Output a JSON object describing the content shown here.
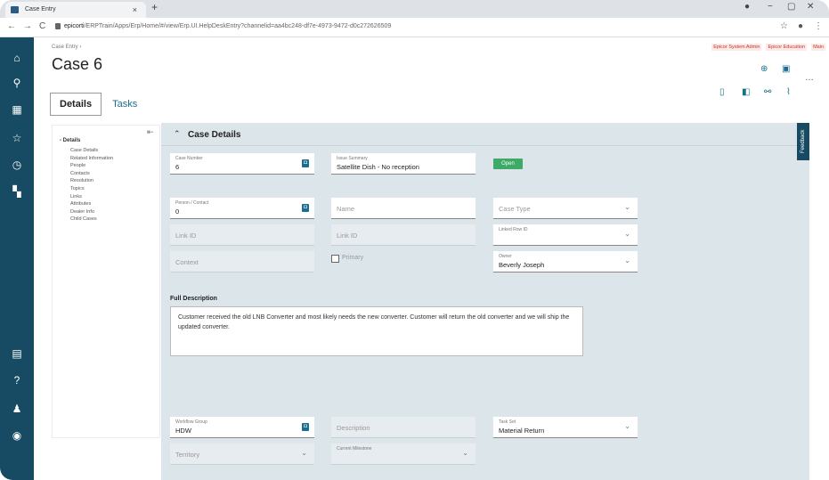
{
  "browser": {
    "tab_title": "Case Entry",
    "tab_close": "×",
    "new_tab": "+",
    "url_host": "epicorti",
    "url_path": "/ERPTrain/Apps/Erp/Home/#/view/Erp.UI.HelpDeskEntry?channelid=aa4bc248-df7e-4973-9472-d0c272626509",
    "back": "←",
    "forward": "→",
    "reload": "C"
  },
  "rail": {
    "icons": [
      "home-icon",
      "search-icon",
      "apps-icon",
      "star-icon",
      "history-icon",
      "dashboard-icon",
      "chat-icon",
      "help-icon",
      "notifications-icon",
      "user-icon"
    ]
  },
  "header": {
    "breadcrumb": "Case Entry  ›",
    "title": "Case 6",
    "links": [
      "Epicor System Admin",
      "Epicor Education",
      "Main"
    ]
  },
  "tabs": {
    "details": "Details",
    "tasks": "Tasks"
  },
  "tree": {
    "collapse_icon": "⇤",
    "root": "- Details",
    "items": [
      "Case Details",
      "Related Information",
      "People",
      "Contacts",
      "Resolution",
      "Topics",
      "Links",
      "Attributes",
      "Dealer Info",
      "Child Cases"
    ]
  },
  "panel": {
    "title": "Case Details",
    "feedback": "Feedback"
  },
  "fields": {
    "case_number": {
      "label": "Case Number",
      "value": "6"
    },
    "issue_summary": {
      "label": "Issue Summary",
      "value": "Satellite Dish - No reception"
    },
    "status": "Open",
    "person_contact": {
      "label": "Person / Contact",
      "value": "0"
    },
    "name": {
      "placeholder": "Name"
    },
    "case_type": {
      "placeholder": "Case Type"
    },
    "link_id_1": {
      "placeholder": "Link ID"
    },
    "link_id_2": {
      "placeholder": "Link ID"
    },
    "linked_row_id": {
      "label": "Linked Row ID"
    },
    "context": {
      "placeholder": "Context"
    },
    "primary": "Primary",
    "owner": {
      "label": "Owner",
      "value": "Beverly Joseph"
    },
    "full_description_label": "Full Description",
    "full_description": "Customer received the old LNB Converter and most likely needs the new converter. Customer will return the old converter and we will ship the updated converter.",
    "workflow_group": {
      "label": "Workflow Group",
      "value": "HDW"
    },
    "description": {
      "placeholder": "Description"
    },
    "task_set": {
      "label": "Task Set",
      "value": "Material Return"
    },
    "territory": {
      "placeholder": "Territory"
    },
    "current_milestone": {
      "label": "Current Milestone"
    }
  }
}
